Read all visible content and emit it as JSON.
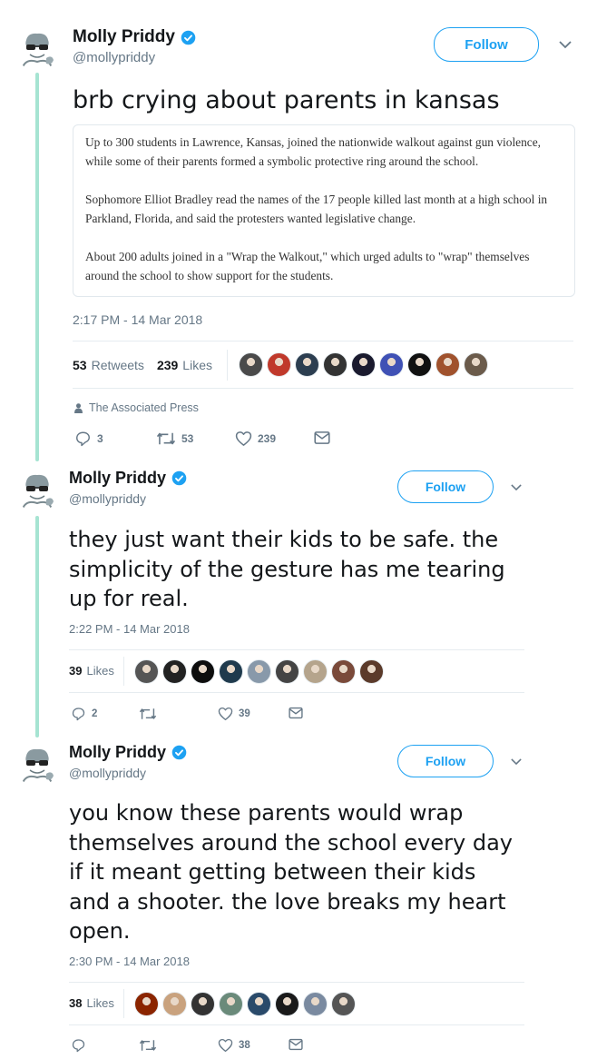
{
  "tweets": [
    {
      "name": "Molly Priddy",
      "handle": "@mollypriddy",
      "follow_label": "Follow",
      "text": "brb crying about parents in kansas",
      "quote": [
        "Up to 300 students in Lawrence, Kansas, joined the nationwide walkout against gun violence, while some of their parents formed a symbolic protective ring around the school.",
        "Sophomore Elliot Bradley read the names of the 17 people killed last month at a high school in Parkland, Florida, and said the protesters wanted legislative change.",
        "About 200 adults joined in a \"Wrap the Walkout,\" which urged adults to \"wrap\" themselves around the school to show support for the students."
      ],
      "timestamp": "2:17 PM - 14 Mar 2018",
      "retweets_count": "53",
      "retweets_label": "Retweets",
      "likes_count": "239",
      "likes_label": "Likes",
      "source": "The Associated Press",
      "actions": {
        "replies": "3",
        "retweets": "53",
        "likes": "239"
      }
    },
    {
      "name": "Molly Priddy",
      "handle": "@mollypriddy",
      "follow_label": "Follow",
      "text": "they just want their kids to be safe. the simplicity of the gesture has me tearing up for real.",
      "timestamp": "2:22 PM - 14 Mar 2018",
      "likes_count": "39",
      "likes_label": "Likes",
      "actions": {
        "replies": "2",
        "retweets": "",
        "likes": "39"
      }
    },
    {
      "name": "Molly Priddy",
      "handle": "@mollypriddy",
      "follow_label": "Follow",
      "text": "you know these parents would wrap themselves around the school every day if it meant getting between their kids and a shooter. the love breaks my heart open.",
      "timestamp": "2:30 PM - 14 Mar 2018",
      "likes_count": "38",
      "likes_label": "Likes",
      "actions": {
        "replies": "",
        "retweets": "",
        "likes": "38"
      }
    }
  ],
  "colors": {
    "thread_line": "#a6e4d2",
    "follow_blue": "#1da1f2",
    "muted": "#657786",
    "faces_t1": [
      "#4a4a4a",
      "#c0392b",
      "#2c3e50",
      "#333333",
      "#1a1a2e",
      "#3f51b5",
      "#111111",
      "#a0522d",
      "#6b5b4b"
    ],
    "faces_t2": [
      "#555555",
      "#222222",
      "#0d0d0d",
      "#1f3a4d",
      "#8899aa",
      "#444444",
      "#b5a48c",
      "#7a4a3a",
      "#5b3a2a"
    ],
    "faces_t3": [
      "#8b2500",
      "#c9a27e",
      "#333333",
      "#6a8a7a",
      "#2a4a6a",
      "#1a1a1a",
      "#7a8aa0",
      "#555555"
    ]
  },
  "icons": [
    "verified-badge-icon",
    "chevron-down-icon",
    "reply-icon",
    "retweet-icon",
    "heart-icon",
    "envelope-icon",
    "person-icon"
  ]
}
